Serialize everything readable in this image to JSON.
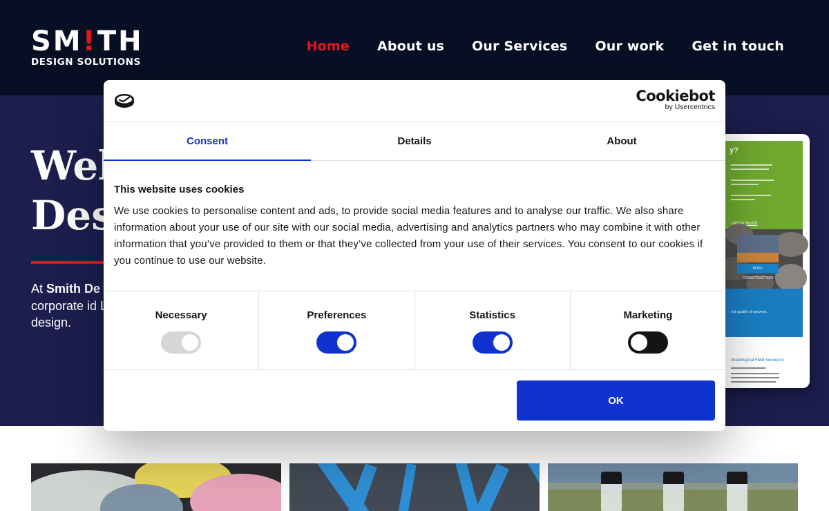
{
  "header": {
    "logo": {
      "main_left": "SM",
      "main_bang": "!",
      "main_right": "TH",
      "sub": "DESIGN SOLUTIONS"
    },
    "nav": [
      {
        "label": "Home",
        "active": true
      },
      {
        "label": "About us",
        "active": false
      },
      {
        "label": "Our Services",
        "active": false
      },
      {
        "label": "Our work",
        "active": false
      },
      {
        "label": "Get in touch",
        "active": false
      }
    ]
  },
  "hero": {
    "title_line1": "Web",
    "title_line2": "Des",
    "text_prefix": "At ",
    "text_bold": "Smith De",
    "text_rest": "corporate id Lanarkshire, graphic desi design."
  },
  "tablet": {
    "heading": "y?",
    "link": "get in touch",
    "button": "POST CONSTRUCTION",
    "blue_text": "est quality of surveys.",
    "foot_title": "chaeological Field Surveyors"
  },
  "cookie_dialog": {
    "brand_main": "Cookiebot",
    "brand_sub": "by Usercentrics",
    "tabs": [
      {
        "label": "Consent",
        "active": true
      },
      {
        "label": "Details",
        "active": false
      },
      {
        "label": "About",
        "active": false
      }
    ],
    "title": "This website uses cookies",
    "body": "We use cookies to personalise content and ads, to provide social media features and to analyse our traffic. We also share information about your use of our site with our social media, advertising and analytics partners who may combine it with other information that you’ve provided to them or that they’ve collected from your use of their services. You consent to our cookies if you continue to use our website.",
    "categories": [
      {
        "label": "Necessary",
        "state": "disabled",
        "checked": true
      },
      {
        "label": "Preferences",
        "state": "on",
        "checked": true
      },
      {
        "label": "Statistics",
        "state": "on",
        "checked": true
      },
      {
        "label": "Marketing",
        "state": "off",
        "checked": false
      }
    ],
    "ok_label": "OK"
  },
  "colors": {
    "header_bg": "#070f24",
    "hero_bg": "#1d1e4e",
    "accent_red": "#e4161d",
    "cookiebot_blue": "#1032cf"
  }
}
